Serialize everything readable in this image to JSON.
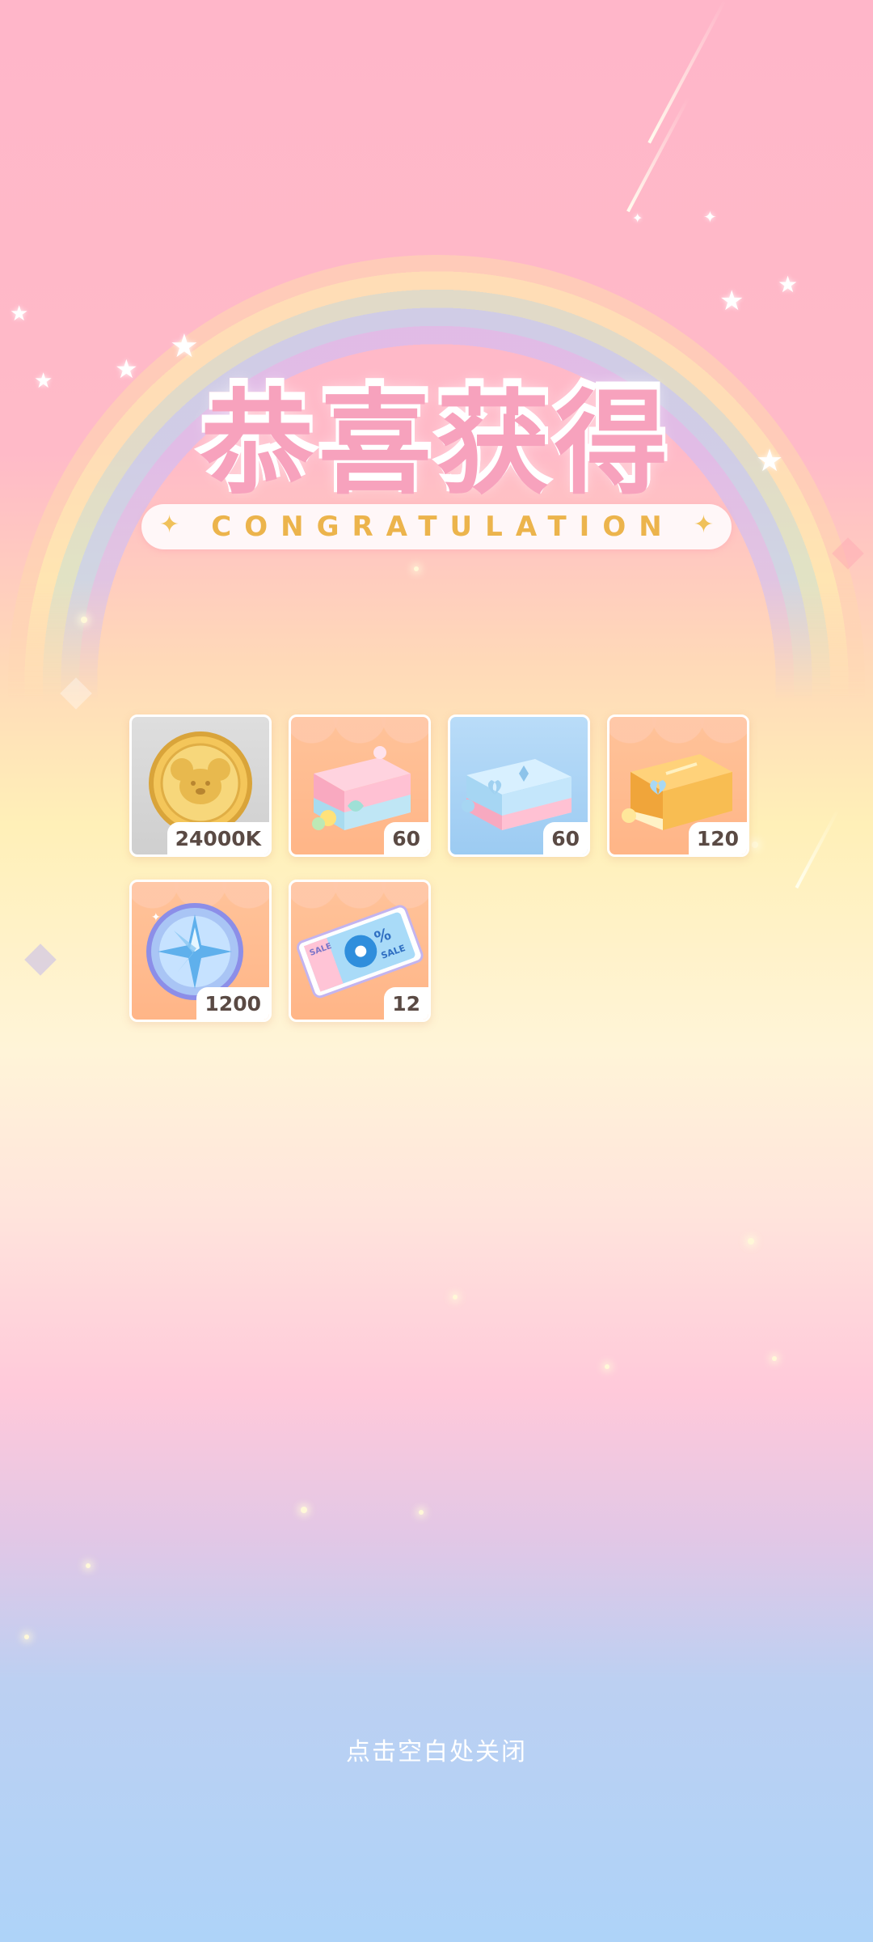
{
  "header": {
    "title": "恭喜获得",
    "subtitle": "CONGRATULATION"
  },
  "rewards": [
    {
      "name": "koala-coin",
      "qty": "24000K"
    },
    {
      "name": "pink-gift-box",
      "qty": "60"
    },
    {
      "name": "blue-gift-box",
      "qty": "60"
    },
    {
      "name": "orange-gift-box",
      "qty": "120"
    },
    {
      "name": "star-compass-coin",
      "qty": "1200"
    },
    {
      "name": "sale-ticket",
      "qty": "12"
    }
  ],
  "ticket_text": {
    "sale": "SALE",
    "percent": "%"
  },
  "footer": {
    "close_hint": "点击空白处关闭"
  },
  "colors": {
    "title": "#ff6fa0",
    "subtitle": "#ecb44c",
    "qty_text": "#5a4a44"
  }
}
